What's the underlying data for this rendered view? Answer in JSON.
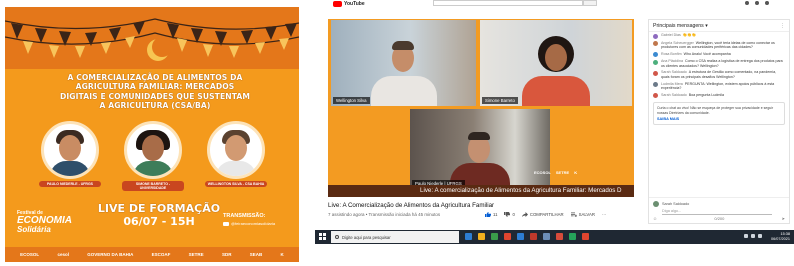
{
  "poster": {
    "title": "A Comercialização de Alimentos da Agricultura Familiar: Mercados Digitais e Comunidades que Sustentam a Agricultura (CSA/BA)",
    "speakers": [
      {
        "tag": "PAULO NIEDERLE - UFRGS",
        "face_color": "#c98c63",
        "hair_color": "#3b2a21",
        "body_color": "#2f4f6a"
      },
      {
        "tag": "SIMONE BARRETO - UNIVERSIDADE",
        "face_color": "#a86c48",
        "hair_color": "#1d1410",
        "body_color": "#3e7d5a"
      },
      {
        "tag": "WELLINGTON SILVA - CSA BAHIA",
        "face_color": "#d29a72",
        "hair_color": "#5a4230",
        "body_color": "#f2f2f2"
      }
    ],
    "event_title": "LIVE DE FORMAÇÃO",
    "event_date": "06/07 - 15H",
    "festival_line1": "Festival de",
    "festival_line2": "ECONOMIA",
    "festival_line3": "Solidária",
    "transmission_label": "TRANSMISSÃO:",
    "transmission_handle": "@feiraeconomiasolidaria",
    "sponsors": [
      "ECOSOL",
      "cesol",
      "GOVERNO DA BAHIA",
      "ESCOAF",
      "SETRE",
      "SDR",
      "SEAB",
      "K"
    ],
    "colors": {
      "orange": "#f49a1c",
      "dark_orange": "#e4771a",
      "flag": "#3b2417"
    }
  },
  "youtube": {
    "logo_text": "YouTube",
    "video": {
      "participants": [
        {
          "name": "Wellington Silva"
        },
        {
          "name": "Simone Barreto"
        },
        {
          "name": "Paulo Niederle | UFRGS"
        }
      ],
      "banner_text": "Live: A comercialização de Alimentos da Agricultura Familiar: Mercados D",
      "logos": [
        "ECOSOL",
        "SETRE",
        "K"
      ]
    },
    "title": "Live: A Comercialização de Alimentos da Agricultura Familiar",
    "meta": "7 assistindo agora • Transmissão iniciada há 45 minutos",
    "actions": {
      "likes": "11",
      "dislikes": "0",
      "share": "COMPARTILHAR",
      "save": "SALVAR"
    },
    "chat": {
      "header": "Principais mensagens",
      "header_caret": "▾",
      "messages": [
        {
          "author": "Gabriel Dias",
          "text": "👏👏👏",
          "color": "#8e6bbf"
        },
        {
          "author": "Angela Scheuergger",
          "text": "Wellington, você teria ideias de como conectar os produtores com as comunidades periféricas das cidades?",
          "color": "#c0774d"
        },
        {
          "author": "Rosa Bonfim",
          "text": "Who Analu! Você acompanha",
          "color": "#3b8bd1"
        },
        {
          "author": "Ana Plácidina",
          "text": "Como o CSA realiza a logística de entrega dos produtos para os clientes associados? Wellington?",
          "color": "#4caf7d"
        },
        {
          "author": "Sarah Saldoado",
          "text": "A estrutura de Gestão como comentado, na pandemia, quais foram os principais desafios Wellington?",
          "color": "#d1574a"
        },
        {
          "author": "Ludmila Mera",
          "text": "PERGUNTA: Wellington, existem apoios públicos à esta experiência?",
          "color": "#6c7a89"
        },
        {
          "author": "Sarah Saldoado",
          "text": "Boa pergunta Ludmila",
          "color": "#d1574a"
        }
      ],
      "notice_text": "Curta o chat ao vivo! Não se esqueça de proteger sua privacidade e seguir nossas Diretrizes da comunidade.",
      "notice_link": "SAIBA MAIS",
      "compose_user": "Sarah Saldoado",
      "compose_placeholder": "Diga algo...",
      "compose_count": "0/200"
    }
  },
  "taskbar": {
    "search_placeholder": "Digite aqui para pesquisar",
    "time": "15:38",
    "date": "06/07/2021",
    "app_colors": [
      "#2d7dd2",
      "#f2b01e",
      "#3a9c4a",
      "#e0452f",
      "#2d7dd2",
      "#c0392b",
      "#6c8eb8",
      "#d84b3b",
      "#25a35a",
      "#e0452f"
    ]
  }
}
